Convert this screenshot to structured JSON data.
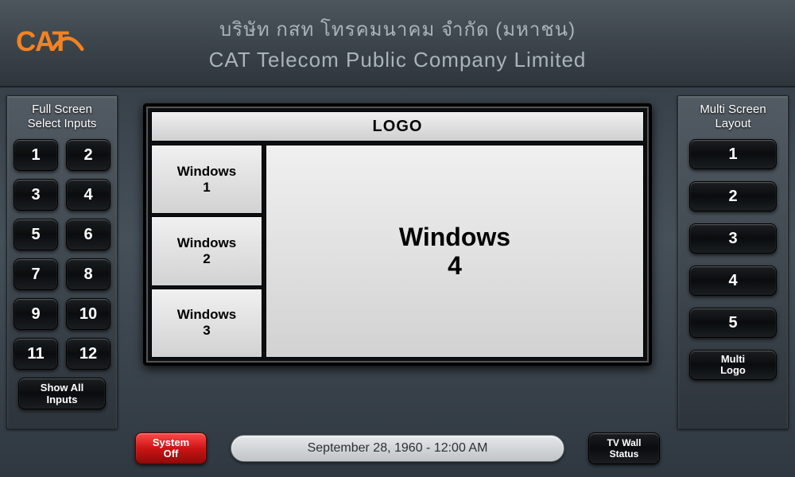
{
  "logo": {
    "text": "CAT"
  },
  "header": {
    "line1": "บริษัท กสท โทรคมนาคม จำกัด (มหาชน)",
    "line2": "CAT Telecom Public Company Limited"
  },
  "left_panel": {
    "title": "Full Screen\nSelect Inputs",
    "buttons": [
      "1",
      "2",
      "3",
      "4",
      "5",
      "6",
      "7",
      "8",
      "9",
      "10",
      "11",
      "12"
    ],
    "show_all": "Show All\nInputs"
  },
  "right_panel": {
    "title": "Multi Screen\nLayout",
    "buttons": [
      "1",
      "2",
      "3",
      "4",
      "5"
    ],
    "multi_logo": "Multi\nLogo"
  },
  "preview": {
    "logo_row": "LOGO",
    "win1": "Windows\n1",
    "win2": "Windows\n2",
    "win3": "Windows\n3",
    "win_big": "Windows\n4"
  },
  "footer": {
    "system_off": "System\nOff",
    "clock": "September 28, 1960  -  12:00 AM",
    "tv_wall": "TV Wall\nStatus"
  }
}
